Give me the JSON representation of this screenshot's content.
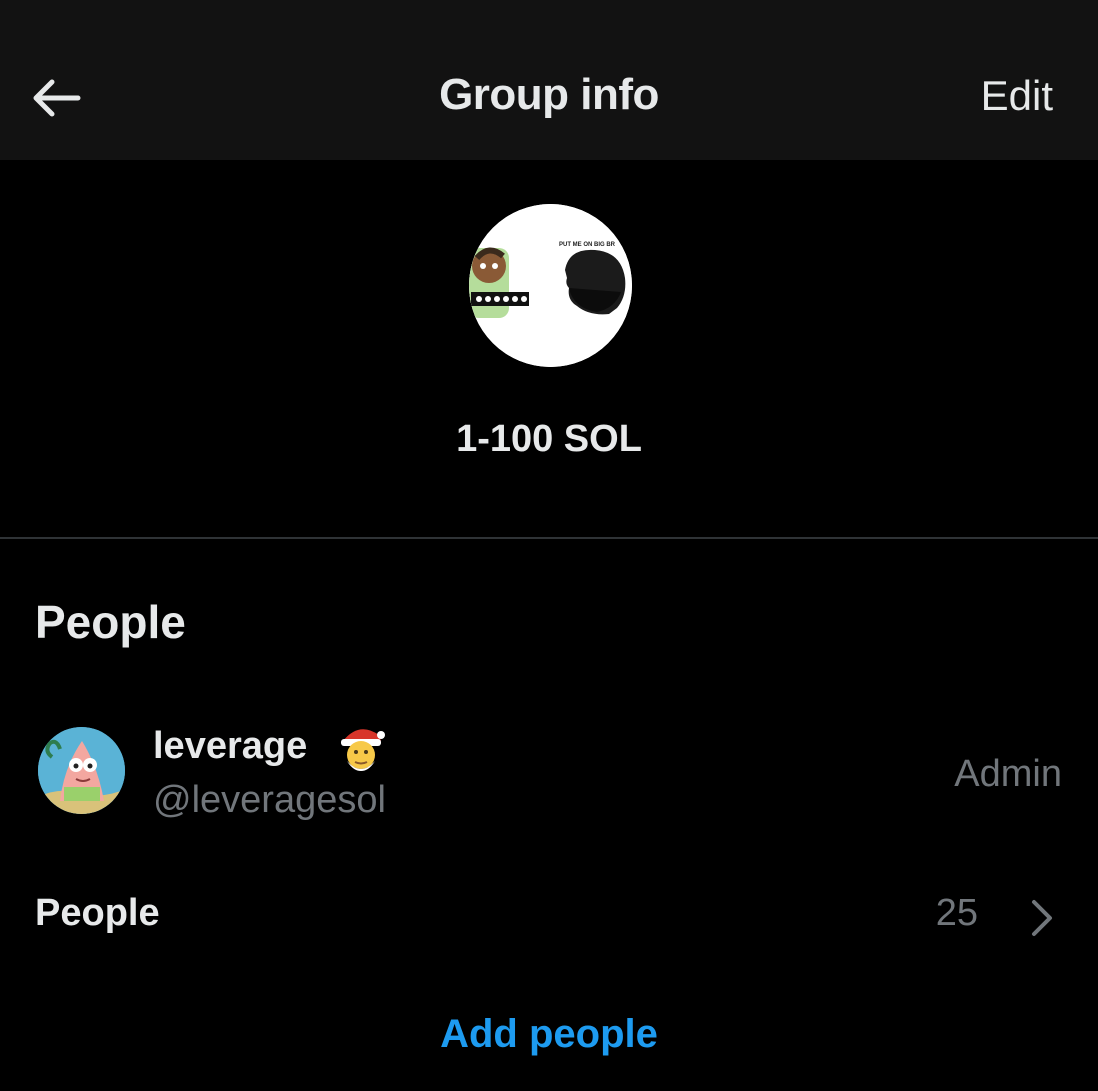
{
  "header": {
    "title": "Group info",
    "edit_label": "Edit",
    "back_icon": "arrow-left-icon"
  },
  "group": {
    "name": "1-100 SOL",
    "avatar_caption": "PUT ME ON BIG BR"
  },
  "people_section": {
    "title": "People",
    "members": [
      {
        "name": "leverage",
        "handle": "@leveragesol",
        "role": "Admin",
        "badge_icon": "santa-emoji-icon"
      }
    ],
    "people_row_label": "People",
    "people_count": "25",
    "chevron_icon": "chevron-right-icon",
    "add_people_label": "Add people"
  },
  "colors": {
    "background": "#000000",
    "header_background": "#121212",
    "primary_text": "#e7e9ea",
    "secondary_text": "#71767b",
    "accent": "#1d9bf0",
    "divider": "#2f3336"
  }
}
